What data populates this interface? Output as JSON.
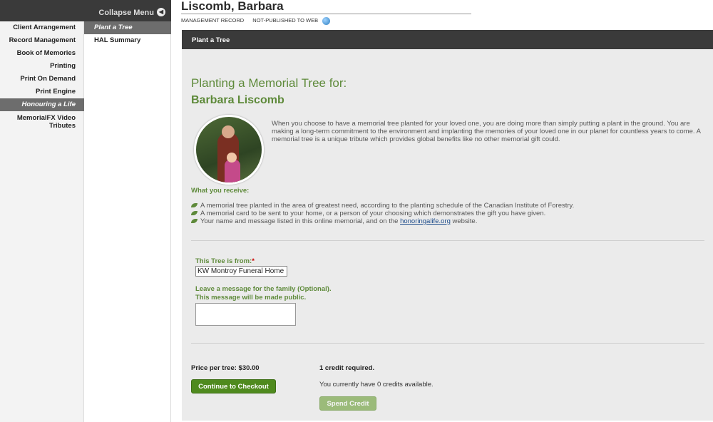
{
  "sidebar": {
    "collapse_label": "Collapse Menu",
    "items": [
      {
        "label": "Client Arrangement"
      },
      {
        "label": "Record Management"
      },
      {
        "label": "Book of Memories"
      },
      {
        "label": "Printing"
      },
      {
        "label": "Print On Demand"
      },
      {
        "label": "Print Engine"
      },
      {
        "label": "Honouring a Life"
      },
      {
        "label": "MemorialFX Video Tributes"
      }
    ],
    "active_item": "Honouring a Life"
  },
  "subnav": {
    "items": [
      {
        "label": "Plant a Tree"
      },
      {
        "label": "HAL Summary"
      }
    ],
    "active_item": "Plant a Tree"
  },
  "header": {
    "name": "Liscomb, Barbara",
    "meta_record": "MANAGEMENT RECORD",
    "meta_status": "NOT-PUBLISHED TO WEB"
  },
  "tab": {
    "label": "Plant a Tree"
  },
  "main": {
    "title": "Planting a Memorial Tree for:",
    "person": "Barbara Liscomb",
    "intro": "When you choose to have a memorial tree planted for your loved one, you are doing more than simply putting a plant in the ground. You are making a long-term commitment to the environment and implanting the memories of your loved one in our planet for countless years to come. A memorial tree is a unique tribute which provides global benefits like no other memorial gift could.",
    "receive_title": "What you receive:",
    "bullets": [
      "A memorial tree planted in the area of greatest need, according to the planting schedule of the Canadian Institute of Forestry.",
      "A memorial card to be sent to your home, or a person of your choosing which demonstrates the gift you have given.",
      "Your name and message listed in this online memorial, and on the "
    ],
    "bullet3_link": "honoringalife.org",
    "bullet3_suffix": " website."
  },
  "form": {
    "from_label": "This Tree is from:",
    "from_value": "KW Montroy Funeral Home",
    "message_label_1": "Leave a message for the family (Optional).",
    "message_label_2": "This message will be made public."
  },
  "checkout": {
    "price_text": "Price per tree: $30.00",
    "credits_required": "1 credit required.",
    "credits_available": "You currently have 0 credits available.",
    "checkout_button": "Continue to Checkout",
    "spend_button": "Spend Credit"
  },
  "colors": {
    "accent_green": "#5e8a3a",
    "button_green": "#4f8a1e",
    "dark_bar": "#3a3a3a"
  }
}
